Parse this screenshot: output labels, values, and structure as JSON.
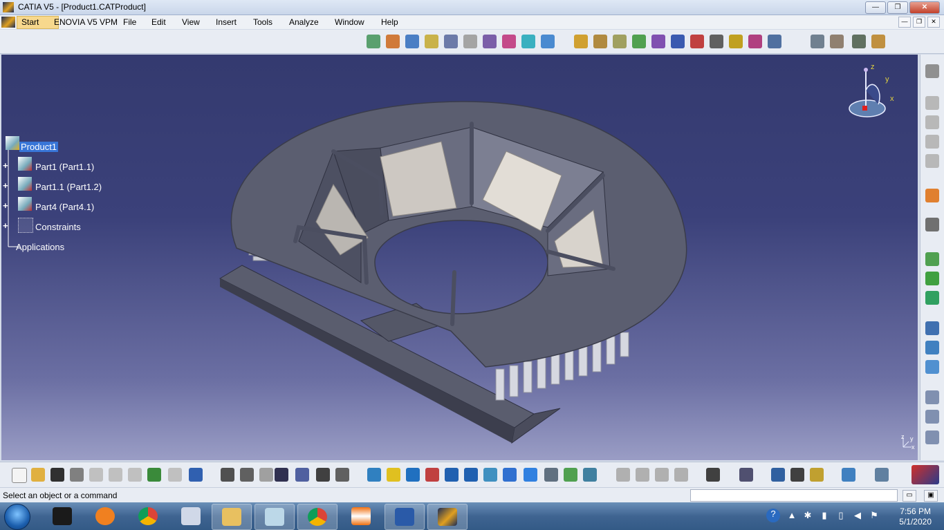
{
  "window": {
    "title": "CATIA V5 - [Product1.CATProduct]"
  },
  "menu": {
    "start": "Start",
    "items": [
      "ENOVIA V5 VPM",
      "File",
      "Edit",
      "View",
      "Insert",
      "Tools",
      "Analyze",
      "Window",
      "Help"
    ]
  },
  "tree": {
    "root": "Product1",
    "children": [
      "Part1 (Part1.1)",
      "Part1.1 (Part1.2)",
      "Part4 (Part4.1)",
      "Constraints"
    ],
    "applications": "Applications"
  },
  "compass": {
    "z": "z",
    "y": "y",
    "x": "x"
  },
  "mini_axes": {
    "z": "z",
    "y": "y",
    "x": "x"
  },
  "status": {
    "message": "Select an object or a command"
  },
  "taskbar": {
    "time": "7:56 PM",
    "date": "5/1/2020"
  },
  "colors": {
    "viewport_top": "#343a6f",
    "viewport_bottom": "#9a9dc5",
    "selection": "#3875d7"
  }
}
